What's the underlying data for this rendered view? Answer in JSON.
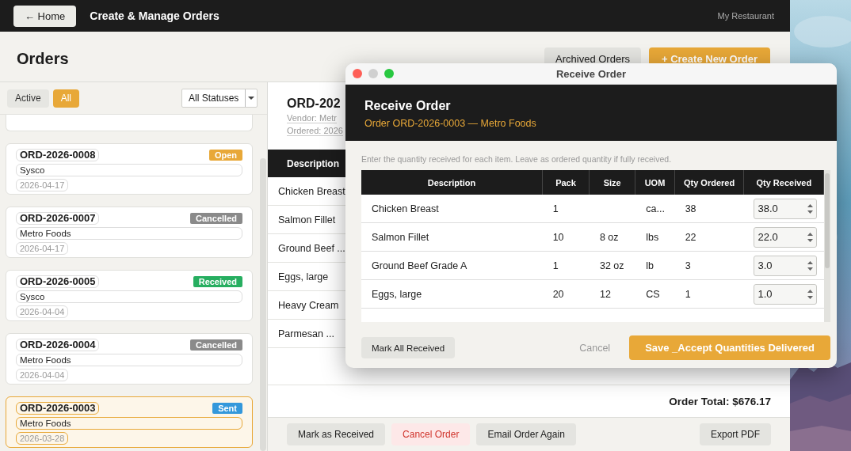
{
  "topbar": {
    "home_button": "← Home",
    "title": "Create & Manage Orders",
    "restaurant": "My Restaurant"
  },
  "header": {
    "title": "Orders",
    "archived_button": "Archived Orders",
    "create_button": "+ Create New Order"
  },
  "filters": {
    "tabs": [
      {
        "label": "Active",
        "selected": false
      },
      {
        "label": "All",
        "selected": true
      }
    ],
    "status_select": "All Statuses"
  },
  "orders": [
    {
      "id": "ORD-2026-0008",
      "status": "Open",
      "color": "#e8a838",
      "vendor": "Sysco",
      "date": "2026-04-17",
      "selected": false
    },
    {
      "id": "ORD-2026-0007",
      "status": "Cancelled",
      "color": "#8a8a8a",
      "vendor": "Metro Foods",
      "date": "2026-04-17",
      "selected": false
    },
    {
      "id": "ORD-2026-0005",
      "status": "Received",
      "color": "#27ae60",
      "vendor": "Sysco",
      "date": "2026-04-04",
      "selected": false
    },
    {
      "id": "ORD-2026-0004",
      "status": "Cancelled",
      "color": "#8a8a8a",
      "vendor": "Metro Foods",
      "date": "2026-04-04",
      "selected": false
    },
    {
      "id": "ORD-2026-0003",
      "status": "Sent",
      "color": "#3498db",
      "vendor": "Metro Foods",
      "date": "2026-03-28",
      "selected": true
    }
  ],
  "detail": {
    "title": "ORD-202",
    "vendor": "Vendor: Metr",
    "ordered": "Ordered: 2026",
    "column": "Description",
    "items": [
      "Chicken Breast",
      "Salmon Fillet",
      "Ground Beef ...",
      "Eggs, large",
      "Heavy Cream",
      "Parmesan ..."
    ],
    "total": "Order Total: $676.17",
    "actions": [
      {
        "label": "Mark as Received",
        "kind": "normal"
      },
      {
        "label": "Cancel Order",
        "kind": "danger"
      },
      {
        "label": "Email Order Again",
        "kind": "normal"
      },
      {
        "label": "Export PDF",
        "kind": "right"
      }
    ]
  },
  "dialog": {
    "window_title": "Receive Order",
    "title": "Receive Order",
    "subtitle": "Order ORD-2026-0003 — Metro Foods",
    "hint": "Enter the quantity received for each item. Leave as ordered quantity if fully received.",
    "columns": [
      "Description",
      "Pack",
      "Size",
      "UOM",
      "Qty Ordered",
      "Qty Received"
    ],
    "rows": [
      {
        "description": "Chicken Breast",
        "pack": "1",
        "uom": "ca...",
        "qty_ordered": "38",
        "qty_received": "38.0"
      },
      {
        "description": "Salmon Fillet",
        "pack": "10",
        "size": "8 oz",
        "uom": "lbs",
        "qty_ordered": "22",
        "qty_received": "22.0"
      },
      {
        "description": "Ground Beef Grade A",
        "pack": "1",
        "size": "32 oz",
        "uom": "lb",
        "qty_ordered": "3",
        "qty_received": "3.0"
      },
      {
        "description": "Eggs, large",
        "pack": "20",
        "size": "12",
        "uom": "CS",
        "qty_ordered": "1",
        "qty_received": "1.0"
      }
    ],
    "mark_all_button": "Mark All Received",
    "cancel_button": "Cancel",
    "save_button": "Save _Accept Quantities Delivered"
  }
}
